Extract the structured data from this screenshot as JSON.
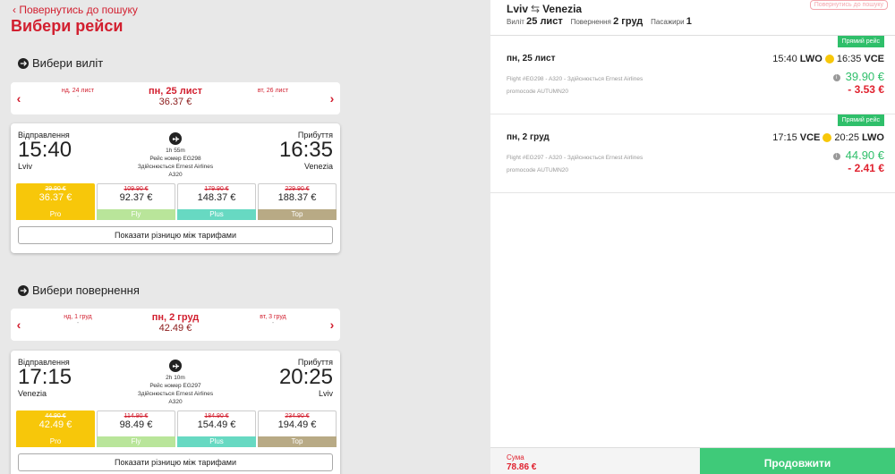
{
  "left": {
    "back_label": "Повернутись до пошуку",
    "title": "Вибери рейси",
    "outbound": {
      "section_title": "Вибери виліт",
      "prev_date": "нд, 24 лист",
      "prev_price": "-",
      "cur_date": "пн, 25 лист",
      "cur_price": "36.37 €",
      "next_date": "вт, 26 лист",
      "next_price": "-",
      "dep_label": "Відправлення",
      "arr_label": "Прибуття",
      "dep_time": "15:40",
      "arr_time": "16:35",
      "dep_city": "Lviv",
      "arr_city": "Venezia",
      "duration": "1h 55m",
      "flight_no": "Рейс номер EG298",
      "operator": "Здійснюється Ernest Airlines",
      "aircraft": "A320",
      "fares": [
        {
          "old": "39.90 €",
          "price": "36.37 €",
          "name": "Pro",
          "color": "#f7c70a"
        },
        {
          "old": "109.90 €",
          "price": "92.37 €",
          "name": "Fly",
          "color": "#b9e59a"
        },
        {
          "old": "179.90 €",
          "price": "148.37 €",
          "name": "Plus",
          "color": "#67d9c2"
        },
        {
          "old": "229.90 €",
          "price": "188.37 €",
          "name": "Top",
          "color": "#b8aa85"
        }
      ],
      "diff_label": "Показати різницю між тарифами"
    },
    "inbound": {
      "section_title": "Вибери повернення",
      "prev_date": "нд, 1 груд",
      "prev_price": "-",
      "cur_date": "пн, 2 груд",
      "cur_price": "42.49 €",
      "next_date": "вт, 3 груд",
      "next_price": "-",
      "dep_label": "Відправлення",
      "arr_label": "Прибуття",
      "dep_time": "17:15",
      "arr_time": "20:25",
      "dep_city": "Venezia",
      "arr_city": "Lviv",
      "duration": "2h 10m",
      "flight_no": "Рейс номер EG297",
      "operator": "Здійснюється Ernest Airlines",
      "aircraft": "A320",
      "fares": [
        {
          "old": "44.90 €",
          "price": "42.49 €",
          "name": "Pro",
          "color": "#f7c70a"
        },
        {
          "old": "114.90 €",
          "price": "98.49 €",
          "name": "Fly",
          "color": "#b9e59a"
        },
        {
          "old": "184.90 €",
          "price": "154.49 €",
          "name": "Plus",
          "color": "#67d9c2"
        },
        {
          "old": "234.90 €",
          "price": "194.49 €",
          "name": "Top",
          "color": "#b8aa85"
        }
      ],
      "diff_label": "Показати різницю між тарифами"
    }
  },
  "right": {
    "from": "Lviv",
    "to": "Venezia",
    "dep_label": "Виліт",
    "dep_value": "25 лист",
    "ret_label": "Повернення",
    "ret_value": "2 груд",
    "pax_label": "Пасажири",
    "pax_value": "1",
    "back_label": "Повернутись до пошуку",
    "legs": [
      {
        "badge": "Прямий рейс",
        "date": "пн, 25 лист",
        "dep_time": "15:40",
        "dep_code": "LWO",
        "arr_time": "16:35",
        "arr_code": "VCE",
        "info": "Flight #EG298 - A320 - Здійснюється Ernest Airlines",
        "promo": "promocode AUTUMN20",
        "price": "39.90 €",
        "discount": "- 3.53 €"
      },
      {
        "badge": "Прямий рейс",
        "date": "пн, 2 груд",
        "dep_time": "17:15",
        "dep_code": "VCE",
        "arr_time": "20:25",
        "arr_code": "LWO",
        "info": "Flight #EG297 - A320 - Здійснюється Ernest Airlines",
        "promo": "promocode AUTUMN20",
        "price": "44.90 €",
        "discount": "- 2.41 €"
      }
    ],
    "sum_label": "Сума",
    "sum_value": "78.86 €",
    "continue_label": "Продовжити"
  }
}
